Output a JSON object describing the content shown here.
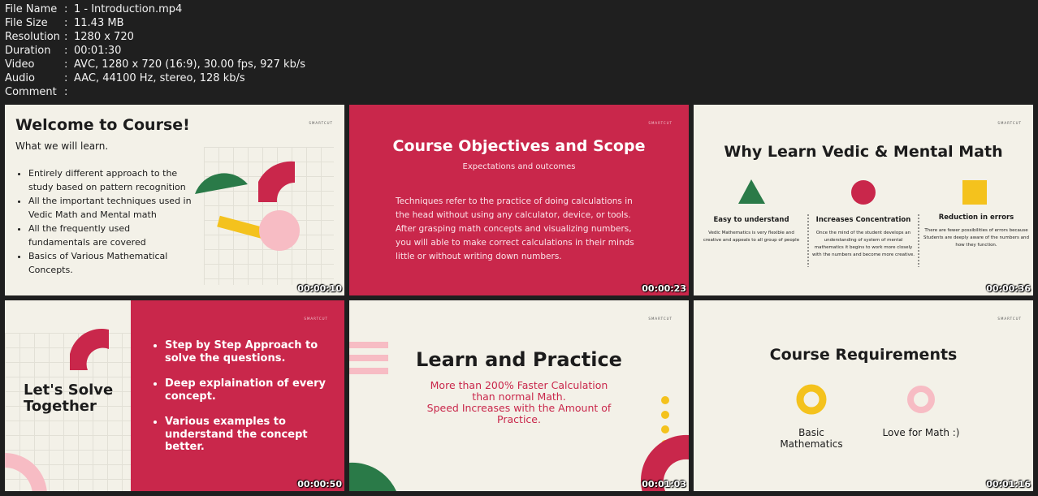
{
  "info": {
    "rows": [
      {
        "k": "File Name",
        "v": "1 - Introduction.mp4"
      },
      {
        "k": "File Size",
        "v": "11.43 MB"
      },
      {
        "k": "Resolution",
        "v": "1280 x 720"
      },
      {
        "k": "Duration",
        "v": "00:01:30"
      },
      {
        "k": "Video",
        "v": "AVC, 1280 x 720 (16:9), 30.00 fps, 927 kb/s"
      },
      {
        "k": "Audio",
        "v": "AAC, 44100 Hz, stereo, 128 kb/s"
      },
      {
        "k": "Comment",
        "v": ""
      }
    ],
    "sep": ":"
  },
  "brand": "SMARTCUT",
  "thumbs": {
    "t1": {
      "title": "Welcome to Course!",
      "subtitle": "What we will learn.",
      "bullets": [
        "Entirely different approach to the study based on pattern recognition",
        "All the important techniques used in Vedic Math and Mental math",
        "All the frequently used fundamentals are covered",
        "Basics of Various Mathematical Concepts."
      ],
      "time": "00:00:10"
    },
    "t2": {
      "title": "Course Objectives and Scope",
      "subtitle": "Expectations and outcomes",
      "body": "Techniques refer to the practice of doing calculations in the head without using any calculator, device, or tools. After grasping math concepts and visualizing numbers, you will able to make correct calculations in their minds little or without writing down numbers.",
      "time": "00:00:23"
    },
    "t3": {
      "title": "Why Learn Vedic & Mental Math",
      "cols": [
        {
          "head": "Easy to understand",
          "text": "Vedic Mathematics is very flexible and creative and appeals to all group of people"
        },
        {
          "head": "Increases Concentration",
          "text": "Once the mind of the student develops an understanding of system of mental mathematics it begins to work more closely with the numbers and become more creative."
        },
        {
          "head": "Reduction in errors",
          "text": "There are fewer possibilities of errors because Students are deeply aware of the numbers and how they function."
        }
      ],
      "time": "00:00:36"
    },
    "t4": {
      "title": "Let's Solve Together",
      "bullets": [
        "Step by Step Approach to solve the questions.",
        "Deep explaination of every concept.",
        "Various examples to understand the concept better."
      ],
      "time": "00:00:50"
    },
    "t5": {
      "title": "Learn and Practice",
      "line1": "More than 200% Faster Calculation",
      "line2": "than normal Math.",
      "line3": "Speed Increases with the Amount of",
      "line4": "Practice.",
      "time": "00:01:03"
    },
    "t6": {
      "title": "Course Requirements",
      "req1": "Basic Mathematics",
      "req2": "Love for Math :)",
      "time": "00:01:16"
    }
  },
  "colors": {
    "red": "#c9274b",
    "green": "#2a7a48",
    "yellow": "#f4c21d",
    "pink": "#f7bcc4",
    "cream": "#f3f1e8"
  }
}
